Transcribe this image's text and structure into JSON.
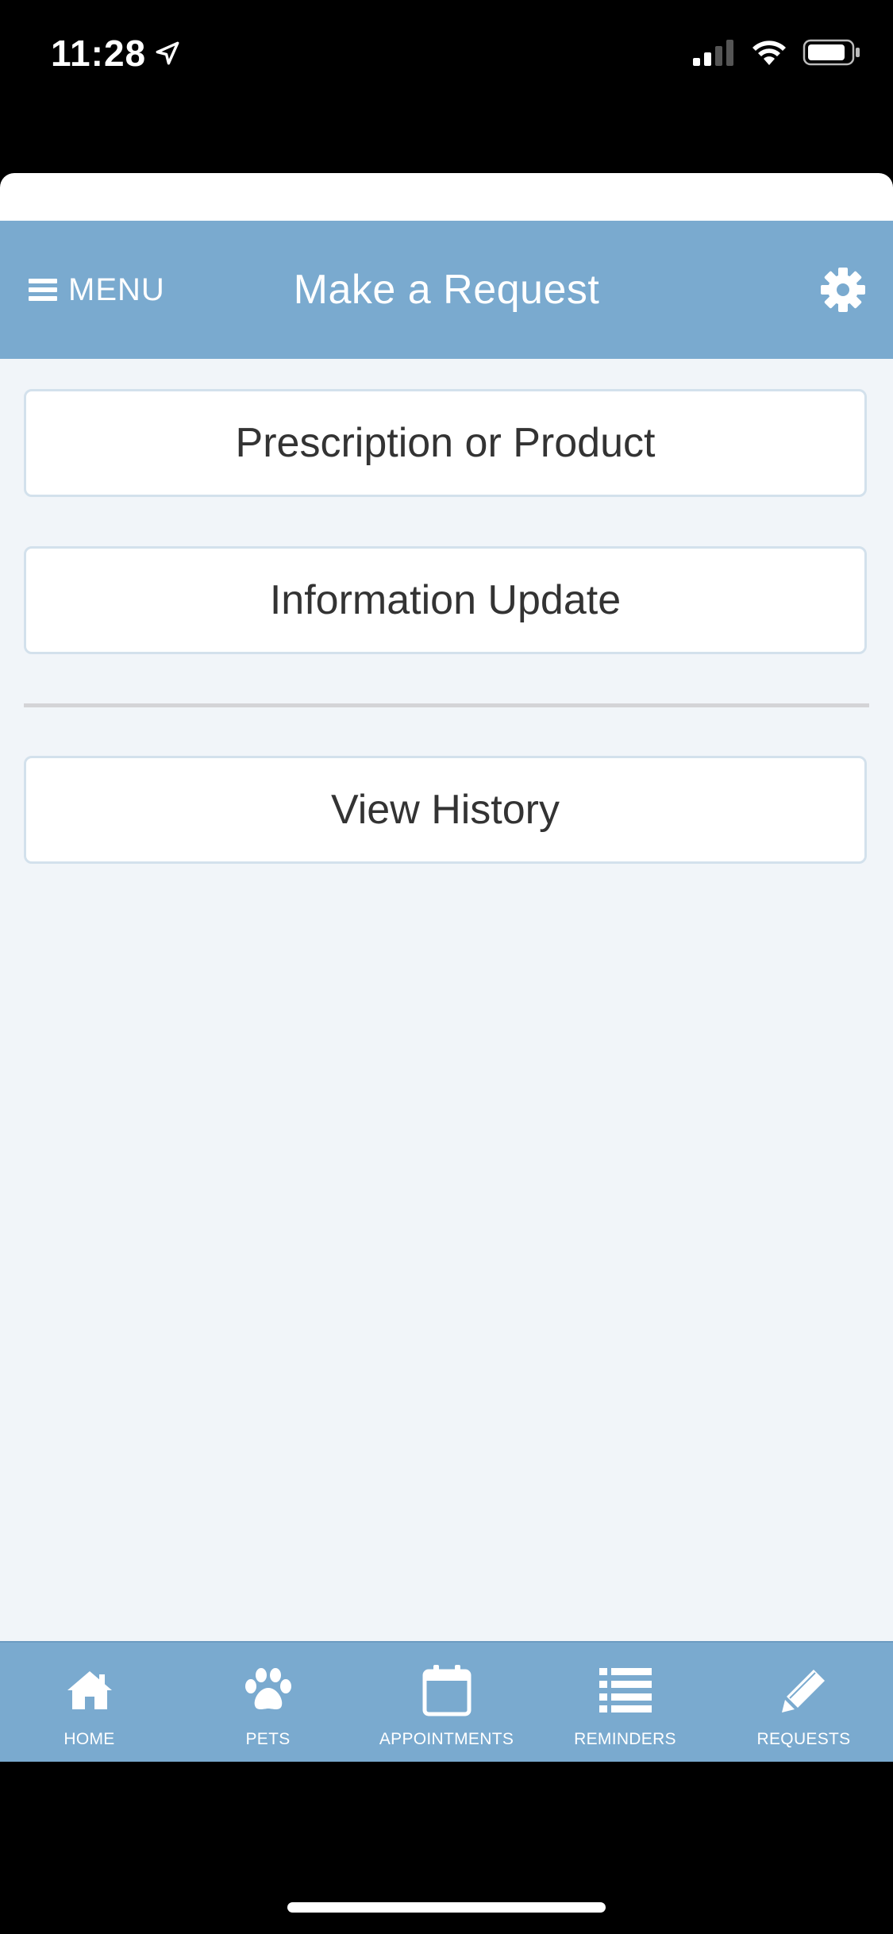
{
  "status_bar": {
    "time": "11:28"
  },
  "header": {
    "menu_label": "MENU",
    "title": "Make a Request"
  },
  "main": {
    "buttons": [
      {
        "label": "Prescription or Product"
      },
      {
        "label": "Information Update"
      },
      {
        "label": "View History"
      }
    ]
  },
  "tabbar": {
    "tabs": [
      {
        "label": "HOME",
        "icon": "home-icon"
      },
      {
        "label": "PETS",
        "icon": "paw-icon"
      },
      {
        "label": "APPOINTMENTS",
        "icon": "calendar-icon"
      },
      {
        "label": "REMINDERS",
        "icon": "list-icon"
      },
      {
        "label": "REQUESTS",
        "icon": "pencil-icon"
      }
    ]
  },
  "colors": {
    "header_bg": "#7aaacf",
    "content_bg": "#f1f5f9",
    "button_border": "#d3e1ec"
  }
}
